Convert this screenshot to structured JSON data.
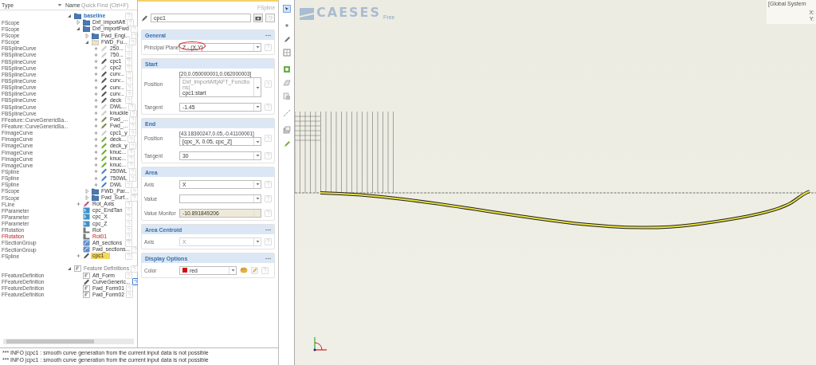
{
  "tree": {
    "columns": [
      "Type",
      "Name"
    ],
    "quick_find": "Quick Find (Ctrl+F)",
    "roots": [
      {
        "name": "baseline",
        "kind": "folder",
        "expanded": true,
        "plus": false,
        "selected": false,
        "warning": false,
        "help_highlighted": false,
        "children": [
          {
            "name": "Dxf_importAft",
            "type": "FScope",
            "kind": "folder",
            "expanded": false,
            "plus": false,
            "selected": false,
            "warning": false,
            "help_highlighted": false
          },
          {
            "name": "Dxf_importFwd",
            "type": "FScope",
            "kind": "folder",
            "expanded": true,
            "plus": false,
            "selected": false,
            "warning": false,
            "help_highlighted": false,
            "children": [
              {
                "name": "Fwd_Engi...",
                "type": "FScope",
                "kind": "folder",
                "expanded": false,
                "plus": false,
                "selected": false,
                "warning": false,
                "help_highlighted": false
              },
              {
                "name": "FWD_Fu...",
                "type": "FScope",
                "kind": "scope",
                "expanded": true,
                "plus": false,
                "selected": false,
                "warning": false,
                "help_highlighted": false,
                "children": [
                  {
                    "name": "250...",
                    "type": "FBSplineCurve",
                    "kind": "faint",
                    "expanded": false,
                    "plus": true,
                    "selected": false,
                    "warning": false,
                    "help_highlighted": false
                  },
                  {
                    "name": "750...",
                    "type": "FBSplineCurve",
                    "kind": "faint",
                    "expanded": false,
                    "plus": true,
                    "selected": false,
                    "warning": false,
                    "help_highlighted": false
                  },
                  {
                    "name": "cpc1",
                    "type": "FBSplineCurve",
                    "kind": "curve",
                    "expanded": false,
                    "plus": true,
                    "selected": false,
                    "warning": false,
                    "help_highlighted": false
                  },
                  {
                    "name": "cpc2",
                    "type": "FBSplineCurve",
                    "kind": "faint",
                    "expanded": false,
                    "plus": true,
                    "selected": false,
                    "warning": false,
                    "help_highlighted": false
                  },
                  {
                    "name": "curv...",
                    "type": "FBSplineCurve",
                    "kind": "curve",
                    "expanded": false,
                    "plus": true,
                    "selected": false,
                    "warning": false,
                    "help_highlighted": false
                  },
                  {
                    "name": "curv...",
                    "type": "FBSplineCurve",
                    "kind": "curve",
                    "expanded": false,
                    "plus": true,
                    "selected": false,
                    "warning": false,
                    "help_highlighted": false
                  },
                  {
                    "name": "curv...",
                    "type": "FBSplineCurve",
                    "kind": "curve",
                    "expanded": false,
                    "plus": true,
                    "selected": false,
                    "warning": false,
                    "help_highlighted": false
                  },
                  {
                    "name": "curv...",
                    "type": "FBSplineCurve",
                    "kind": "curve",
                    "expanded": false,
                    "plus": true,
                    "selected": false,
                    "warning": false,
                    "help_highlighted": false
                  },
                  {
                    "name": "deck",
                    "type": "FBSplineCurve",
                    "kind": "curve",
                    "expanded": false,
                    "plus": true,
                    "selected": false,
                    "warning": false,
                    "help_highlighted": false
                  },
                  {
                    "name": "DWL...",
                    "type": "FBSplineCurve",
                    "kind": "faint",
                    "expanded": false,
                    "plus": true,
                    "selected": false,
                    "warning": false,
                    "help_highlighted": false
                  },
                  {
                    "name": "knuckle",
                    "type": "FBSplineCurve",
                    "kind": "faint",
                    "expanded": false,
                    "plus": true,
                    "selected": false,
                    "warning": false,
                    "help_highlighted": false
                  },
                  {
                    "name": "Fwd_...",
                    "type": "FFeature::CurveGenericBa...",
                    "kind": "feature-curve",
                    "expanded": false,
                    "plus": true,
                    "selected": false,
                    "warning": false,
                    "help_highlighted": false
                  },
                  {
                    "name": "Fwd_...",
                    "type": "FFeature::CurveGenericBa...",
                    "kind": "feature-curve",
                    "expanded": false,
                    "plus": true,
                    "selected": false,
                    "warning": false,
                    "help_highlighted": false
                  },
                  {
                    "name": "cpc1_y",
                    "type": "FImageCurve",
                    "kind": "faint",
                    "expanded": false,
                    "plus": true,
                    "selected": false,
                    "warning": false,
                    "help_highlighted": false
                  },
                  {
                    "name": "deck...",
                    "type": "FImageCurve",
                    "kind": "image",
                    "expanded": false,
                    "plus": true,
                    "selected": false,
                    "warning": false,
                    "help_highlighted": false
                  },
                  {
                    "name": "deck_y",
                    "type": "FImageCurve",
                    "kind": "image",
                    "expanded": false,
                    "plus": true,
                    "selected": false,
                    "warning": false,
                    "help_highlighted": false
                  },
                  {
                    "name": "knuc...",
                    "type": "FImageCurve",
                    "kind": "image",
                    "expanded": false,
                    "plus": true,
                    "selected": false,
                    "warning": false,
                    "help_highlighted": false
                  },
                  {
                    "name": "knuc...",
                    "type": "FImageCurve",
                    "kind": "image",
                    "expanded": false,
                    "plus": true,
                    "selected": false,
                    "warning": false,
                    "help_highlighted": false
                  },
                  {
                    "name": "knuc...",
                    "type": "FImageCurve",
                    "kind": "image",
                    "expanded": false,
                    "plus": true,
                    "selected": false,
                    "warning": false,
                    "help_highlighted": false
                  },
                  {
                    "name": "250WL",
                    "type": "FSpline",
                    "kind": "spline",
                    "expanded": false,
                    "plus": true,
                    "selected": false,
                    "warning": false,
                    "help_highlighted": false
                  },
                  {
                    "name": "750WL",
                    "type": "FSpline",
                    "kind": "spline",
                    "expanded": false,
                    "plus": true,
                    "selected": false,
                    "warning": false,
                    "help_highlighted": false
                  },
                  {
                    "name": "DWL",
                    "type": "FSpline",
                    "kind": "spline",
                    "expanded": false,
                    "plus": true,
                    "selected": false,
                    "warning": false,
                    "help_highlighted": false
                  }
                ]
              },
              {
                "name": "FWD_Par...",
                "type": "FScope",
                "kind": "folder",
                "expanded": false,
                "plus": false,
                "selected": false,
                "warning": false,
                "help_highlighted": false
              },
              {
                "name": "Fwd_Surf...",
                "type": "FScope",
                "kind": "folder",
                "expanded": false,
                "plus": false,
                "selected": false,
                "warning": false,
                "help_highlighted": false
              }
            ]
          },
          {
            "name": "Rot_Axis",
            "type": "FLine",
            "kind": "line",
            "expanded": false,
            "plus": true,
            "selected": false,
            "warning": false,
            "help_highlighted": false
          },
          {
            "name": "cpc_EndTan",
            "type": "FParameter",
            "kind": "parameter",
            "expanded": false,
            "plus": false,
            "selected": false,
            "warning": false,
            "help_highlighted": false
          },
          {
            "name": "cpc_X",
            "type": "FParameter",
            "kind": "parameter",
            "expanded": false,
            "plus": false,
            "selected": false,
            "warning": false,
            "help_highlighted": false
          },
          {
            "name": "cpc_Z",
            "type": "FParameter",
            "kind": "parameter",
            "expanded": false,
            "plus": false,
            "selected": false,
            "warning": false,
            "help_highlighted": false
          },
          {
            "name": "Rot",
            "type": "FRotation",
            "kind": "rotation",
            "expanded": false,
            "plus": false,
            "selected": false,
            "warning": false,
            "help_highlighted": false
          },
          {
            "name": "Rot01",
            "type": "FRotation",
            "kind": "rotation",
            "expanded": false,
            "plus": false,
            "selected": false,
            "warning": true,
            "help_highlighted": false
          },
          {
            "name": "Aft_sections",
            "type": "FSectionGroup",
            "kind": "section",
            "expanded": false,
            "plus": false,
            "selected": false,
            "warning": false,
            "help_highlighted": false
          },
          {
            "name": "Fwd_sections...",
            "type": "FSectionGroup",
            "kind": "section",
            "expanded": false,
            "plus": false,
            "selected": false,
            "warning": false,
            "help_highlighted": false
          },
          {
            "name": "cpc1",
            "type": "FSpline",
            "kind": "curve",
            "expanded": false,
            "plus": true,
            "selected": true,
            "warning": false,
            "help_highlighted": false
          }
        ]
      },
      {
        "name": "Feature Definitions",
        "kind": "feature",
        "expanded": true,
        "plus": false,
        "selected": false,
        "warning": false,
        "help_highlighted": false,
        "children": [
          {
            "name": "Aft_Form",
            "type": "FFeatureDefinition",
            "kind": "feature",
            "expanded": false,
            "plus": false,
            "selected": false,
            "warning": false,
            "help_highlighted": false
          },
          {
            "name": "CurveGeneric...",
            "type": "FFeatureDefinition",
            "kind": "curve",
            "expanded": false,
            "plus": false,
            "selected": false,
            "warning": false,
            "help_highlighted": true
          },
          {
            "name": "Fwd_Form01",
            "type": "FFeatureDefinition",
            "kind": "feature",
            "expanded": false,
            "plus": false,
            "selected": false,
            "warning": false,
            "help_highlighted": false
          },
          {
            "name": "Fwd_Form02",
            "type": "FFeatureDefinition",
            "kind": "feature",
            "expanded": false,
            "plus": false,
            "selected": false,
            "warning": false,
            "help_highlighted": false
          }
        ]
      }
    ]
  },
  "properties": {
    "type_label": "FSpline",
    "name": "cpc1",
    "sections": [
      {
        "title": "General",
        "menu": true,
        "fields": [
          {
            "label": "Principal Plane",
            "kind": "select",
            "value": "Z - (X,Y)",
            "circled": true,
            "disabled": false
          }
        ]
      },
      {
        "title": "Start",
        "menu": false,
        "fields": [
          {
            "label": "Position",
            "kind": "reference",
            "resolved": "[20,0.050000001,0.062000003]",
            "source": "Dxf_importAft|AFT_Functions|",
            "value": "cpc1:start",
            "circled": false,
            "disabled": false
          },
          {
            "label": "Tangent",
            "kind": "select",
            "value": "-1.45",
            "circled": false,
            "disabled": false
          }
        ]
      },
      {
        "title": "End",
        "menu": false,
        "fields": [
          {
            "label": "Position",
            "kind": "reference",
            "resolved": "[43.18300247,0.05,-0.41100001]",
            "value": "[cpc_X, 0.05, cpc_Z]",
            "circled": false,
            "disabled": false
          },
          {
            "label": "Tangent",
            "kind": "select",
            "value": "30",
            "circled": false,
            "disabled": false
          }
        ]
      },
      {
        "title": "Area",
        "menu": false,
        "fields": [
          {
            "label": "Axis",
            "kind": "select",
            "value": "X",
            "circled": false,
            "disabled": false
          },
          {
            "label": "Value",
            "kind": "select",
            "circled": false,
            "disabled": false
          },
          {
            "label": "Value Monitor",
            "kind": "readonly",
            "value": "-10.891849206",
            "circled": false,
            "disabled": false
          }
        ]
      },
      {
        "title": "Area Centroid",
        "menu": true,
        "fields": [
          {
            "label": "Axis",
            "kind": "select",
            "value": "X",
            "circled": false,
            "disabled": true
          }
        ]
      },
      {
        "title": "Display Options",
        "menu": true,
        "fields": [
          {
            "label": "Color",
            "kind": "color",
            "value": "red",
            "color": "#d01010",
            "circled": false,
            "disabled": false
          }
        ]
      }
    ]
  },
  "viewer": {
    "logo": "CAESES",
    "logo_tag": "Free",
    "coordinates": {
      "title": "[Global System",
      "x": "X:",
      "y": "Y:"
    }
  },
  "log": [
    "*** INFO |cpc1 : smooth curve generation from the current input data is not possible",
    "*** INFO |cpc1 : smooth curve generation from the current input data is not possible"
  ]
}
